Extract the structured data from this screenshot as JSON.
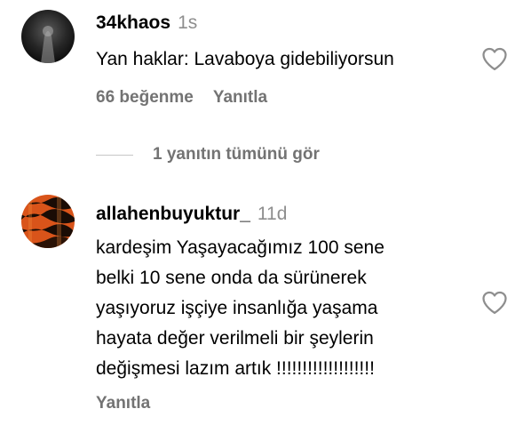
{
  "comments": [
    {
      "username": "34khaos",
      "time": "1s",
      "text_lines": [
        "Yan haklar: Lavaboya gidebiliyorsun"
      ],
      "likes": "66 beğenme",
      "reply_label": "Yanıtla"
    },
    {
      "username": "allahenbuyuktur_",
      "time": "11d",
      "text_lines": [
        "kardeşim Yaşayacağımız 100 sene",
        "belki 10 sene onda da sürünerek",
        "yaşıyoruz işçiye insanlığa yaşama",
        "hayata değer verilmeli bir şeylerin",
        "değişmesi lazım artık !!!!!!!!!!!!!!!!!!!"
      ],
      "reply_label": "Yanıtla"
    }
  ],
  "view_replies_label": "1 yanıtın tümünü gör",
  "colors": {
    "secondary_text": "#737373",
    "timestamp": "#8e8e8e",
    "divider": "#c7c7c7",
    "heart_stroke": "#8e8e8e"
  }
}
